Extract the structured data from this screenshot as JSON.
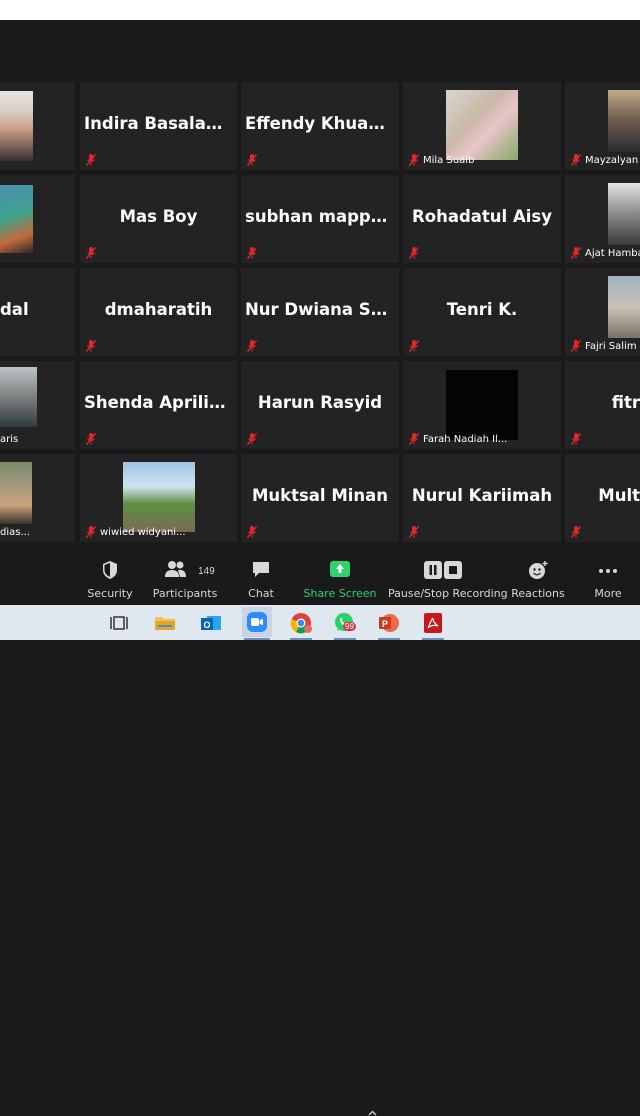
{
  "participants": [
    {
      "label": "",
      "video": "photo"
    },
    {
      "label": "Indira Basalamah",
      "video": "none"
    },
    {
      "label": "Effendy Khuandy",
      "video": "none"
    },
    {
      "label": "Mila Suaib",
      "video": "photo"
    },
    {
      "label": "Mayzalyan",
      "video": "photo"
    },
    {
      "label": "",
      "video": "photo"
    },
    {
      "label": "Mas Boy",
      "video": "none"
    },
    {
      "label": "subhan  mappat...",
      "video": "none"
    },
    {
      "label": "Rohadatul Aisy",
      "video": "none"
    },
    {
      "label": "Ajat Hamba",
      "video": "photo"
    },
    {
      "label": "dal",
      "video": "none"
    },
    {
      "label": "dmaharatih",
      "video": "none"
    },
    {
      "label": "Nur  Dwiana  Sar...",
      "video": "none"
    },
    {
      "label": "Tenri K.",
      "video": "none"
    },
    {
      "label": "Fajri Salim",
      "video": "photo"
    },
    {
      "label": "aris",
      "video": "photo"
    },
    {
      "label": "Shenda  Aprilia...",
      "video": "none"
    },
    {
      "label": "Harun Rasyid",
      "video": "none"
    },
    {
      "label": "Farah Nadiah Il...",
      "video": "photo"
    },
    {
      "label": "fitr",
      "video": "none"
    },
    {
      "label": "dias...",
      "video": "photo"
    },
    {
      "label": "wiwied widyani...",
      "video": "photo"
    },
    {
      "label": "Muktsal Minan",
      "video": "none"
    },
    {
      "label": "Nurul Kariimah",
      "video": "none"
    },
    {
      "label": "Mult",
      "video": "none"
    }
  ],
  "toolbar": {
    "security": "Security",
    "participants": "Participants",
    "participants_count": "149",
    "chat": "Chat",
    "share_screen": "Share Screen",
    "recording": "Pause/Stop Recording",
    "reactions": "Reactions",
    "more": "More"
  },
  "taskbar": {
    "apps": [
      "task-view-icon",
      "file-explorer-icon",
      "outlook-icon",
      "zoom-icon",
      "chrome-icon",
      "whatsapp-icon",
      "powerpoint-icon",
      "pdf-reader-icon"
    ],
    "whatsapp_badge": "99"
  },
  "colors": {
    "tile_bg": "#232323",
    "share_green": "#2dd36f",
    "mic_red": "#e02828",
    "taskbar_bg": "#dfe7f1"
  }
}
